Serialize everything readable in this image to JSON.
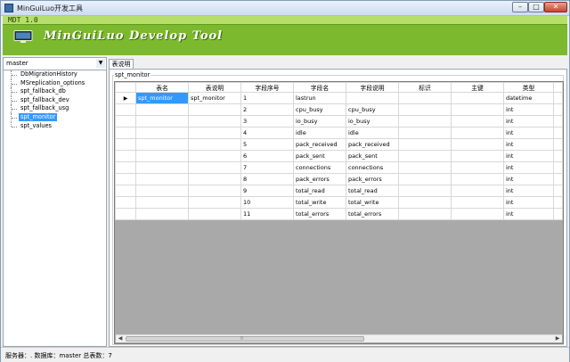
{
  "window": {
    "title": "MinGuiLuo开发工具",
    "minimize": "–",
    "maximize": "□",
    "close": "✕"
  },
  "banner": {
    "version": "MDT 1.0",
    "brand": "MinGuiLuo Develop Tool",
    "background": "#7db92e"
  },
  "sidebar": {
    "database": "master",
    "tables": [
      {
        "label": "DbMigrationHistory",
        "selected": false
      },
      {
        "label": "MSreplication_options",
        "selected": false
      },
      {
        "label": "spt_fallback_db",
        "selected": false
      },
      {
        "label": "spt_fallback_dev",
        "selected": false
      },
      {
        "label": "spt_fallback_usg",
        "selected": false
      },
      {
        "label": "spt_monitor",
        "selected": true
      },
      {
        "label": "spt_values",
        "selected": false
      }
    ]
  },
  "main": {
    "tab": "表说明",
    "group_title": "spt_monitor",
    "columns": [
      "表名",
      "表说明",
      "字段序号",
      "字段名",
      "字段说明",
      "标识",
      "主键",
      "类型"
    ],
    "rows": [
      [
        "spt_monitor",
        "spt_monitor",
        "1",
        "lastrun",
        "",
        "",
        "",
        "datetime"
      ],
      [
        "",
        "",
        "2",
        "cpu_busy",
        "cpu_busy",
        "",
        "",
        "int"
      ],
      [
        "",
        "",
        "3",
        "io_busy",
        "io_busy",
        "",
        "",
        "int"
      ],
      [
        "",
        "",
        "4",
        "idle",
        "idle",
        "",
        "",
        "int"
      ],
      [
        "",
        "",
        "5",
        "pack_received",
        "pack_received",
        "",
        "",
        "int"
      ],
      [
        "",
        "",
        "6",
        "pack_sent",
        "pack_sent",
        "",
        "",
        "int"
      ],
      [
        "",
        "",
        "7",
        "connections",
        "connections",
        "",
        "",
        "int"
      ],
      [
        "",
        "",
        "8",
        "pack_errors",
        "pack_errors",
        "",
        "",
        "int"
      ],
      [
        "",
        "",
        "9",
        "total_read",
        "total_read",
        "",
        "",
        "int"
      ],
      [
        "",
        "",
        "10",
        "total_write",
        "total_write",
        "",
        "",
        "int"
      ],
      [
        "",
        "",
        "11",
        "total_errors",
        "total_errors",
        "",
        "",
        "int"
      ]
    ],
    "current_row_marker": "▶"
  },
  "status": {
    "text": "服务器：. 数据库：master 总表数：7"
  },
  "colors": {
    "accent": "#7db92e",
    "selection": "#3399ff"
  }
}
